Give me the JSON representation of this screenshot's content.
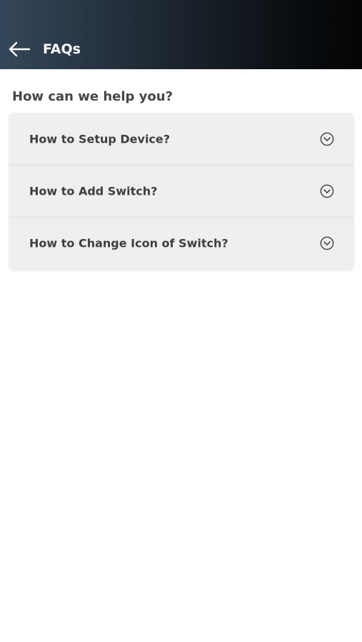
{
  "header": {
    "title": "FAQs",
    "back_icon": "arrow-left-icon"
  },
  "main": {
    "heading": "How can we help you?",
    "faq_items": [
      {
        "question": "How to Setup Device?",
        "icon": "chevron-down-circle-icon",
        "expanded": false
      },
      {
        "question": "How to Add Switch?",
        "icon": "chevron-down-circle-icon",
        "expanded": false
      },
      {
        "question": "How to Change Icon of Switch?",
        "icon": "chevron-down-circle-icon",
        "expanded": false
      }
    ]
  },
  "colors": {
    "header_gradient_start": "#35475a",
    "header_gradient_end": "#030405",
    "card_background": "#efefef",
    "text_primary": "#3e3e3e",
    "header_text": "#ffffff"
  }
}
